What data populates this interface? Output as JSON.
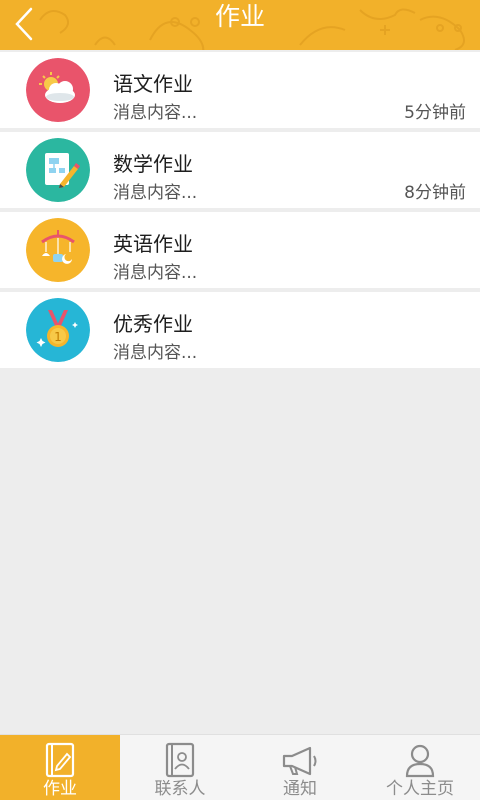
{
  "header": {
    "title": "作业",
    "back_icon": "chevron-left-icon",
    "background": "#f2b12a"
  },
  "items": [
    {
      "title": "语文作业",
      "message": "消息内容...",
      "time": "5分钟前",
      "icon": "sun-cloud-icon",
      "color": "#e9546b"
    },
    {
      "title": "数学作业",
      "message": "消息内容...",
      "time": "8分钟前",
      "icon": "document-pencil-icon",
      "color": "#2bb7a0"
    },
    {
      "title": "英语作业",
      "message": "消息内容...",
      "time": "",
      "icon": "mobile-toy-icon",
      "color": "#f6b52b"
    },
    {
      "title": "优秀作业",
      "message": "消息内容...",
      "time": "",
      "icon": "medal-icon",
      "color": "#26b6d6"
    }
  ],
  "tabbar": {
    "active_color": "#f2b12a",
    "tabs": [
      {
        "label": "作业",
        "icon": "notebook-icon",
        "active": true
      },
      {
        "label": "联系人",
        "icon": "contact-book-icon",
        "active": false
      },
      {
        "label": "通知",
        "icon": "megaphone-icon",
        "active": false
      },
      {
        "label": "个人主页",
        "icon": "person-icon",
        "active": false
      }
    ]
  }
}
